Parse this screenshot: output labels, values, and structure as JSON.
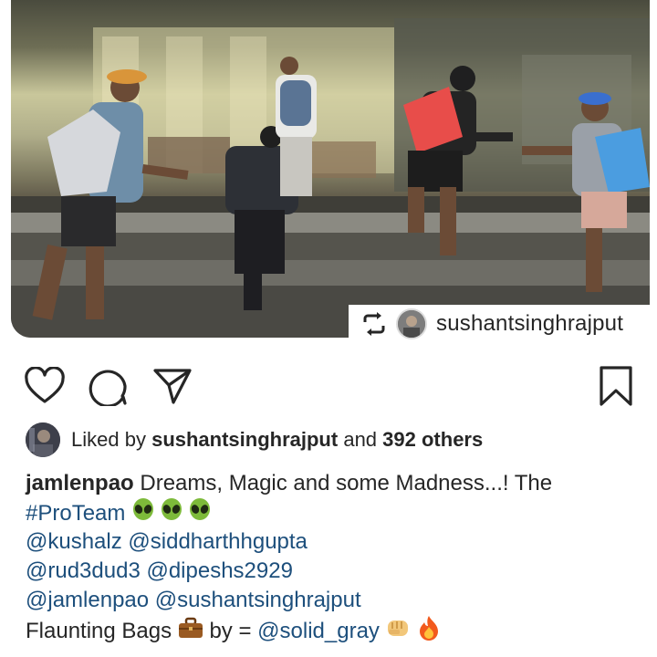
{
  "post": {
    "repost": {
      "icon": "repost-icon",
      "username": "sushantsinghrajput"
    },
    "actions": {
      "like_icon": "heart-icon",
      "comment_icon": "comment-icon",
      "share_icon": "send-icon",
      "save_icon": "bookmark-icon"
    },
    "likes": {
      "prefix": "Liked by",
      "user": "sushantsinghrajput",
      "middle": "and",
      "count": "392 others"
    },
    "caption": {
      "username": "jamlenpao",
      "text1": "Dreams, Magic and some Madness...! The",
      "hashtag": "#ProTeam",
      "mentions_line1": "@kushalz @siddharthhgupta",
      "mentions_line2": "@rud3dud3 @dipeshs2929",
      "mentions_line3": "@jamlenpao @sushantsinghrajput",
      "flaunt_prefix": "Flaunting Bags",
      "flaunt_mid": "by =",
      "flaunt_mention": "@solid_gray"
    }
  },
  "colors": {
    "link": "#1d4f7c",
    "text": "#262626",
    "background": "#ffffff"
  }
}
